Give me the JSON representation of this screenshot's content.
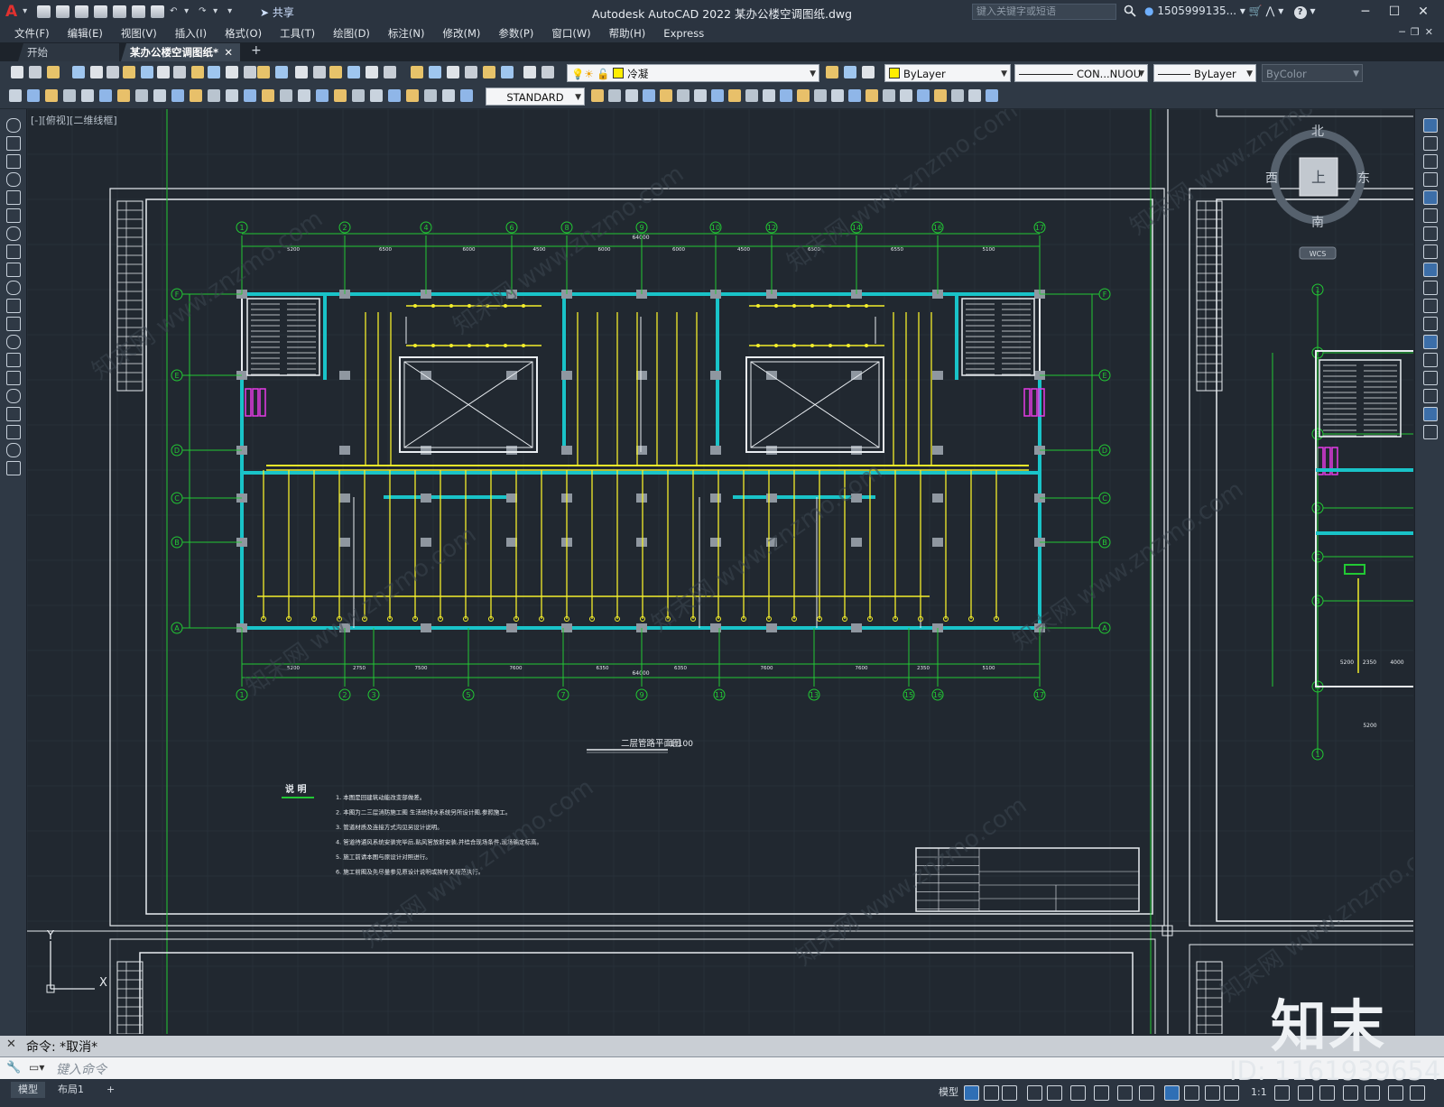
{
  "app": {
    "logo": "A",
    "title": "Autodesk AutoCAD 2022    某办公楼空调图纸.dwg",
    "share_label": "共享",
    "search_placeholder": "键入关键字或短语",
    "user": "1505999135...",
    "help": "?"
  },
  "menu": [
    "文件(F)",
    "编辑(E)",
    "视图(V)",
    "插入(I)",
    "格式(O)",
    "工具(T)",
    "绘图(D)",
    "标注(N)",
    "修改(M)",
    "参数(P)",
    "窗口(W)",
    "帮助(H)",
    "Express"
  ],
  "tabs": {
    "start": "开始",
    "drawing": "某办公楼空调图纸*",
    "close": "✕",
    "add": "+"
  },
  "toolbar": {
    "layer": "冷凝",
    "color": "ByLayer",
    "linetype": "CON...NUOU",
    "lineweight": "ByLayer",
    "plotstyle": "ByColor",
    "textstyle": "STANDARD",
    "layer_color": "#ffee00"
  },
  "canvas": {
    "view_label": "[-][俯视][二维线框]",
    "compass": {
      "n": "北",
      "s": "南",
      "e": "东",
      "w": "西",
      "top": "上",
      "wcs": "WCS"
    },
    "ucs": {
      "y": "Y",
      "x": "X"
    },
    "plan_title": "二层管路平面图",
    "plan_scale": "1:100",
    "notes_title": "说 明",
    "notes": [
      "1. 本图是回建筑动能改变部做差。",
      "2. 本图为二三层消防施工图 生活给排水系统另所设计图,参照施工。",
      "3. 管道材质及连接方式沟见另设计说明。",
      "4. 管道待通风系统安装完毕后,贴风管放射安装,并结合现场条件,现场确定标高。",
      "5. 施工前请本图与原设计对照进行。",
      "6. 施工前图及先尽量参见原设计说明或按有关规范执行。"
    ],
    "axes_top": [
      "1",
      "2",
      "4",
      "6",
      "8",
      "9",
      "10",
      "12",
      "14",
      "16",
      "17"
    ],
    "axes_bottom": [
      "1",
      "2",
      "3",
      "5",
      "7",
      "9",
      "11",
      "13",
      "15",
      "16",
      "17"
    ],
    "axes_left": [
      "F",
      "E",
      "D",
      "C",
      "B",
      "A"
    ],
    "dims_top": [
      "5200",
      "6500",
      "6000",
      "4500",
      "6000",
      "6000",
      "4500",
      "6500",
      "6550",
      "5100"
    ],
    "dims_bottom": [
      "5200",
      "2750",
      "7500",
      "7600",
      "6350",
      "6350",
      "7600",
      "7600",
      "2350",
      "5100"
    ],
    "overall_dim": "64000",
    "right_axes": [
      "1",
      "F",
      "E",
      "D",
      "C",
      "B",
      "A",
      "1"
    ],
    "right_dims": [
      "5200",
      "2350",
      "4000",
      "5200"
    ]
  },
  "command": {
    "history": "命令: *取消*",
    "placeholder": "键入命令"
  },
  "status": {
    "model_tab": "模型",
    "layout_tab": "布局1",
    "add": "+",
    "model_label": "模型",
    "scale": "1:1"
  },
  "watermark": {
    "logo": "知末",
    "id": "ID: 1161939654",
    "site": "知末网 www.znzmo.com"
  }
}
